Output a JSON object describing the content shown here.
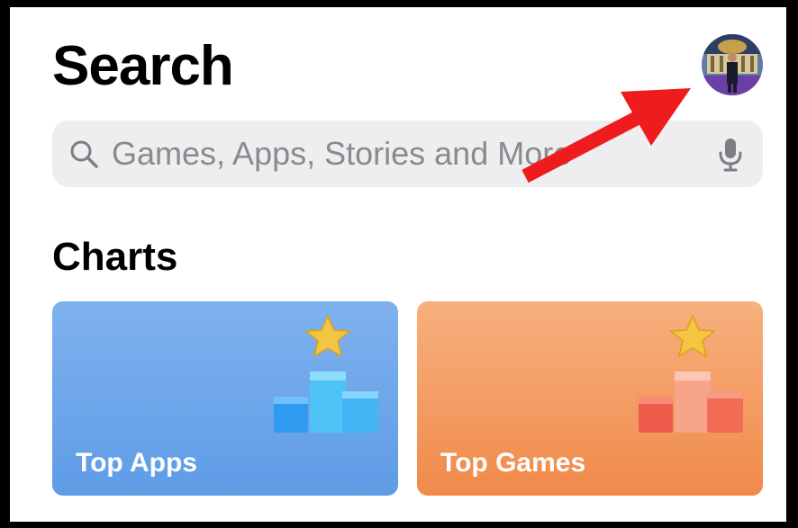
{
  "header": {
    "title": "Search"
  },
  "search": {
    "placeholder": "Games, Apps, Stories and More"
  },
  "charts": {
    "section_title": "Charts",
    "cards": [
      {
        "label": "Top Apps"
      },
      {
        "label": "Top Games"
      }
    ]
  },
  "colors": {
    "apps_card": "#6aa6ea",
    "games_card": "#f39a5d",
    "annotation_arrow": "#ee1c1c"
  },
  "icons": {
    "search": "search-icon",
    "mic": "microphone-icon",
    "avatar": "profile-avatar",
    "podium": "podium-star-icon"
  }
}
